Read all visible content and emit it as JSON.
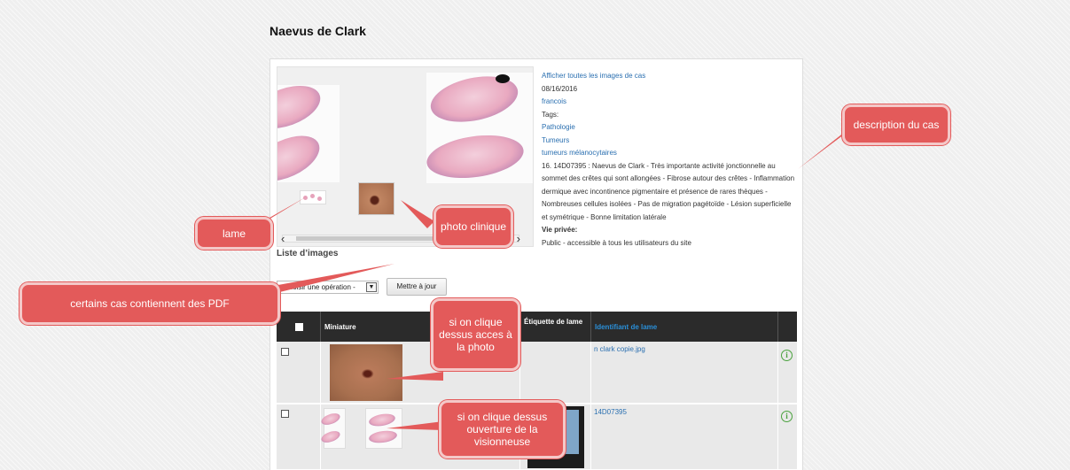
{
  "page": {
    "title": "Naevus de Clark"
  },
  "case": {
    "show_all_images_link": "Afficher toutes les images de cas",
    "date": "08/16/2016",
    "author": "francois",
    "tags_label": "Tags:",
    "tags": [
      "Pathologie",
      "Tumeurs",
      "tumeurs mélanocytaires"
    ],
    "description": "16. 14D07395 : Naevus de Clark - Très importante activité jonctionnelle au sommet des crêtes qui sont allongées - Fibrose autour des crêtes - Inflammation dermique avec incontinence pigmentaire et présence de rares thèques - Nombreuses cellules isolées - Pas de migration pagétoïde - Lésion superficielle et symétrique - Bonne limitation latérale",
    "privacy_label": "Vie privée:",
    "privacy_value": "Public - accessible à tous les utilisateurs du site"
  },
  "image_list": {
    "title": "Liste d’images",
    "operation_select": "- Choisir une opération -",
    "update_button": "Mettre à jour",
    "columns": {
      "miniature": "Miniature",
      "etiquette": "Étiquette de lame",
      "identifiant": "Identifiant de lame"
    },
    "rows": [
      {
        "identifiant": "n clark copie.jpg"
      },
      {
        "identifiant": "14D07395"
      }
    ]
  },
  "callouts": {
    "lame": "lame",
    "photo_clinique": "photo clinique",
    "description": "description du cas",
    "pdf": "certains cas contiennent des PDF",
    "photo_access": "si on clique dessus acces à la photo",
    "viewer_open": "si on clique dessus ouverture de la visionneuse"
  },
  "colors": {
    "callout": "#e35a5a",
    "link": "#2a6fb0",
    "table_header": "#2b2b2b",
    "info_icon": "#4aa23e"
  },
  "icons": {
    "info": "info-icon",
    "checkbox": "checkbox",
    "dropdown": "chevron-down-icon"
  }
}
